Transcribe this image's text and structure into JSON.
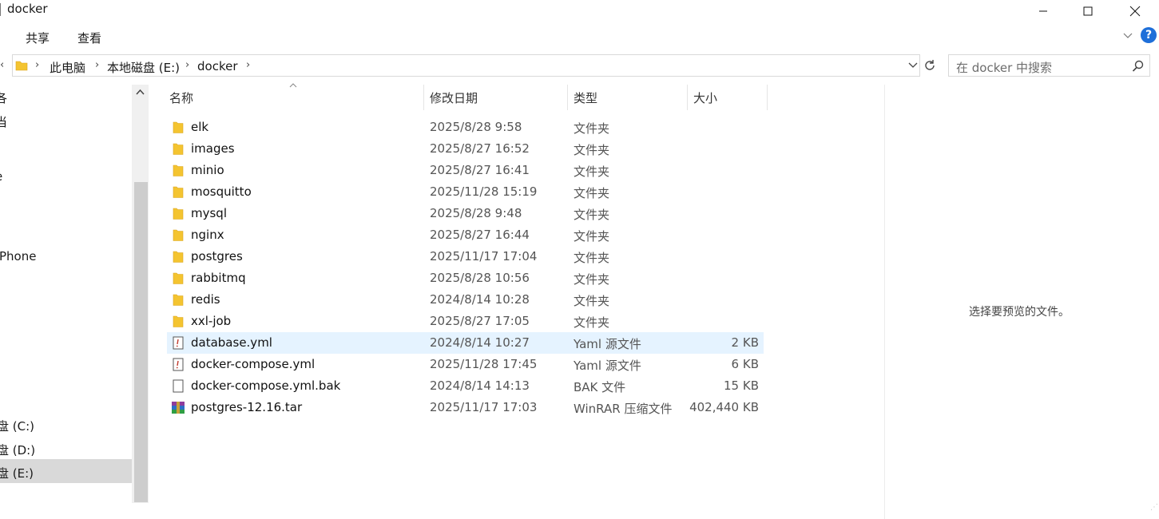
{
  "window": {
    "title": "docker"
  },
  "ribbon": {
    "tabs": [
      "共享",
      "查看"
    ]
  },
  "address": {
    "crumbs": [
      "此电脑",
      "本地磁盘 (E:)",
      "docker"
    ]
  },
  "search": {
    "placeholder": "在 docker 中搜索"
  },
  "nav": {
    "partial_items": [
      "各",
      "当",
      "e",
      "Phone",
      "盘 (C:)",
      "盘 (D:)",
      "盘 (E:)"
    ],
    "selected": "盘 (E:)"
  },
  "columns": {
    "name": "名称",
    "date": "修改日期",
    "type": "类型",
    "size": "大小"
  },
  "files": [
    {
      "name": "elk",
      "date": "2025/8/28 9:58",
      "type": "文件夹",
      "size": "",
      "icon": "folder-icon"
    },
    {
      "name": "images",
      "date": "2025/8/27 16:52",
      "type": "文件夹",
      "size": "",
      "icon": "folder-icon"
    },
    {
      "name": "minio",
      "date": "2025/8/27 16:41",
      "type": "文件夹",
      "size": "",
      "icon": "folder-icon"
    },
    {
      "name": "mosquitto",
      "date": "2025/11/28 15:19",
      "type": "文件夹",
      "size": "",
      "icon": "folder-icon"
    },
    {
      "name": "mysql",
      "date": "2025/8/28 9:48",
      "type": "文件夹",
      "size": "",
      "icon": "folder-icon"
    },
    {
      "name": "nginx",
      "date": "2025/8/27 16:44",
      "type": "文件夹",
      "size": "",
      "icon": "folder-icon"
    },
    {
      "name": "postgres",
      "date": "2025/11/17 17:04",
      "type": "文件夹",
      "size": "",
      "icon": "folder-icon"
    },
    {
      "name": "rabbitmq",
      "date": "2025/8/28 10:56",
      "type": "文件夹",
      "size": "",
      "icon": "folder-icon"
    },
    {
      "name": "redis",
      "date": "2024/8/14 10:28",
      "type": "文件夹",
      "size": "",
      "icon": "folder-icon"
    },
    {
      "name": "xxl-job",
      "date": "2025/8/27 17:05",
      "type": "文件夹",
      "size": "",
      "icon": "folder-icon"
    },
    {
      "name": "database.yml",
      "date": "2024/8/14 10:27",
      "type": "Yaml 源文件",
      "size": "2 KB",
      "icon": "yaml-file-icon"
    },
    {
      "name": "docker-compose.yml",
      "date": "2025/11/28 17:45",
      "type": "Yaml 源文件",
      "size": "6 KB",
      "icon": "yaml-file-icon"
    },
    {
      "name": "docker-compose.yml.bak",
      "date": "2024/8/14 14:13",
      "type": "BAK 文件",
      "size": "15 KB",
      "icon": "file-icon"
    },
    {
      "name": "postgres-12.16.tar",
      "date": "2025/11/17 17:03",
      "type": "WinRAR 压缩文件",
      "size": "402,440 KB",
      "icon": "winrar-icon"
    }
  ],
  "preview": {
    "message": "选择要预览的文件。"
  },
  "colors": {
    "selection": "#e5f3ff",
    "folder": "#f4c430",
    "help": "#1e6fd9"
  }
}
